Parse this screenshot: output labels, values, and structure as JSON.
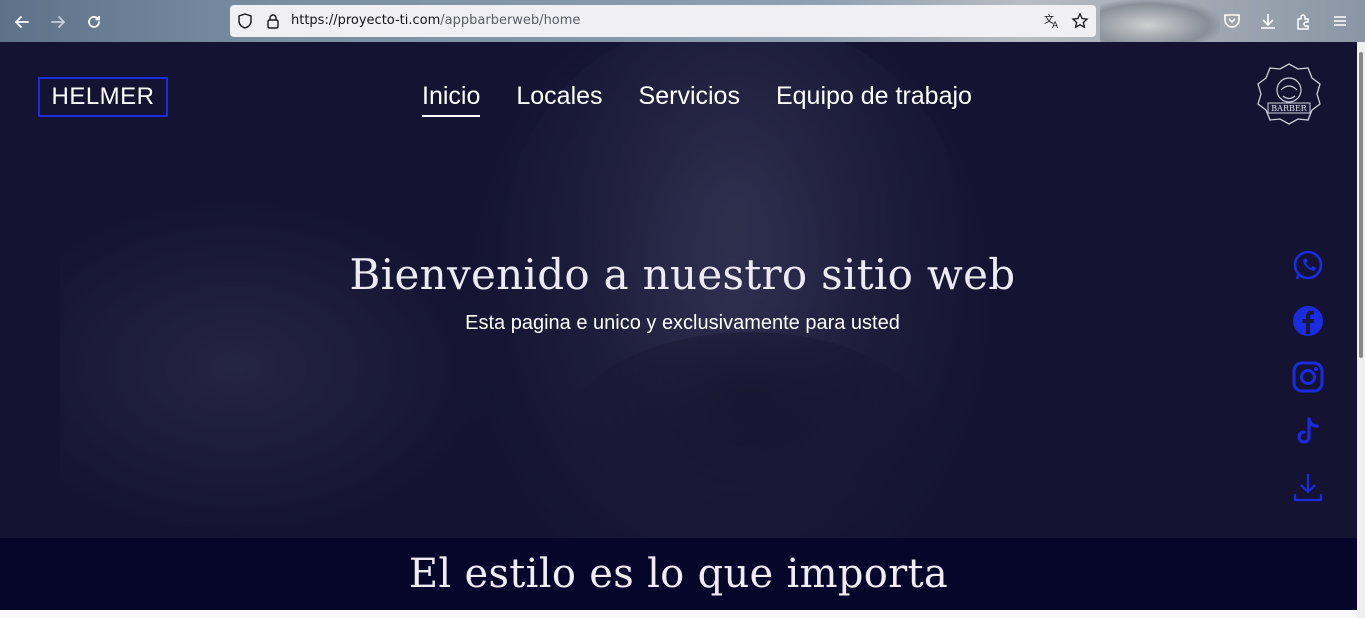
{
  "browser": {
    "url_host": "https://proyecto-ti.com",
    "url_path": "/appbarberweb/home",
    "icons": [
      "back-arrow-icon",
      "forward-arrow-icon",
      "reload-icon",
      "shield-icon",
      "lock-icon",
      "translate-icon",
      "star-icon",
      "pocket-icon",
      "download-icon",
      "extensions-icon",
      "hamburger-menu-icon"
    ]
  },
  "site": {
    "brand": "HELMER",
    "nav": [
      "Inicio",
      "Locales",
      "Servicios",
      "Equipo de trabajo"
    ],
    "active_nav": "Inicio",
    "logo_text": "BARBER",
    "accent_color": "#1a2be0",
    "band_color": "#06062a"
  },
  "hero": {
    "title": "Bienvenido a nuestro sitio web",
    "subtitle": "Esta pagina e unico y exclusivamente para usted"
  },
  "social": [
    "whatsapp-icon",
    "facebook-icon",
    "instagram-icon",
    "tiktok-icon",
    "download-icon"
  ],
  "band": {
    "text": "El estilo es lo que importa"
  }
}
